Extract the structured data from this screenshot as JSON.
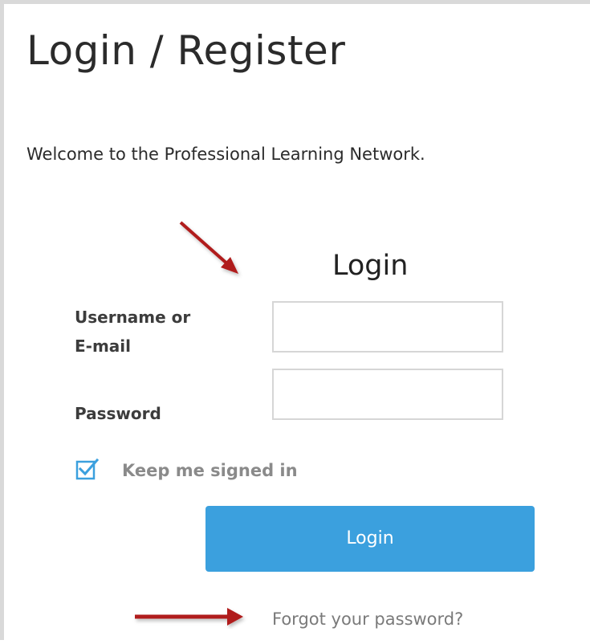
{
  "page": {
    "title": "Login / Register",
    "welcome": "Welcome to the Professional Learning Network."
  },
  "login_form": {
    "heading": "Login",
    "username_label_line1": "Username or",
    "username_label_line2": "E-mail",
    "username_value": "",
    "password_label": "Password",
    "password_value": "",
    "remember_label": "Keep me signed in",
    "remember_checked": true,
    "submit_label": "Login",
    "forgot_link": "Forgot your password?"
  },
  "colors": {
    "accent": "#3ba0de",
    "annotation_arrow": "#b01a1a"
  }
}
